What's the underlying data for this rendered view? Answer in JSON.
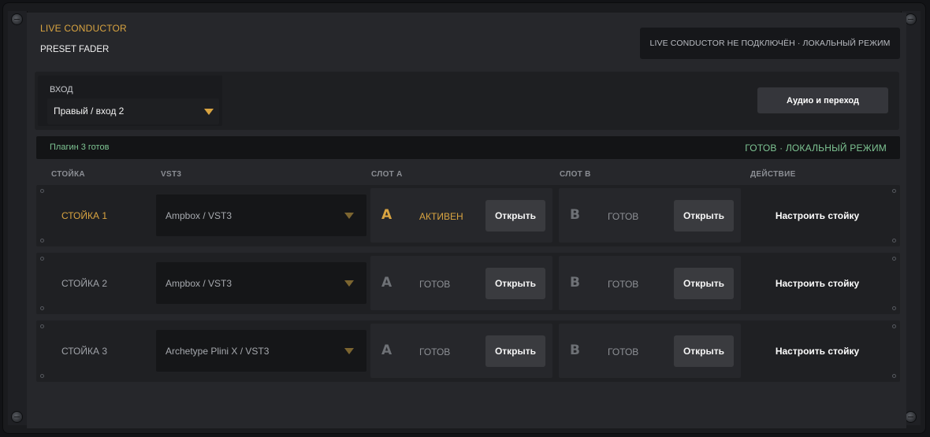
{
  "header": {
    "brand": "LIVE CONDUCTOR",
    "subtitle": "PRESET FADER",
    "connection_status": "LIVE CONDUCTOR НЕ ПОДКЛЮЧЁН · ЛОКАЛЬНЫЙ РЕЖИМ"
  },
  "input": {
    "label": "ВХОД",
    "selected": "Правый / вход 2"
  },
  "audio_button": "Аудио и переход",
  "info": {
    "left": "Плагин 3 готов",
    "right": "ГОТОВ · ЛОКАЛЬНЫЙ РЕЖИМ"
  },
  "columns": {
    "rack": "СТОЙКА",
    "vst": "VST3",
    "slot_a": "СЛОТ A",
    "slot_b": "СЛОТ B",
    "action": "ДЕЙСТВИЕ"
  },
  "racks": [
    {
      "name": "СТОЙКА 1",
      "plugin": "Ampbox / VST3",
      "slot_a": {
        "letter": "A",
        "status": "АКТИВЕН",
        "button": "Открыть"
      },
      "slot_b": {
        "letter": "B",
        "status": "ГОТОВ",
        "button": "Открыть"
      },
      "action": "Настроить стойку"
    },
    {
      "name": "СТОЙКА 2",
      "plugin": "Ampbox / VST3",
      "slot_a": {
        "letter": "A",
        "status": "ГОТОВ",
        "button": "Открыть"
      },
      "slot_b": {
        "letter": "B",
        "status": "ГОТОВ",
        "button": "Открыть"
      },
      "action": "Настроить стойку"
    },
    {
      "name": "СТОЙКА 3",
      "plugin": "Archetype Plini X / VST3",
      "slot_a": {
        "letter": "A",
        "status": "ГОТОВ",
        "button": "Открыть"
      },
      "slot_b": {
        "letter": "B",
        "status": "ГОТОВ",
        "button": "Открыть"
      },
      "action": "Настроить стойку"
    }
  ],
  "colors": {
    "accent": "#d9a441",
    "ok": "#7ec593",
    "background": "#26272b"
  }
}
